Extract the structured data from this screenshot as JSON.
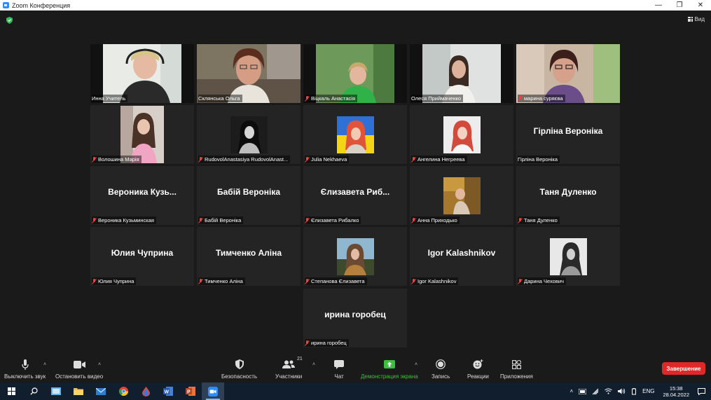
{
  "window": {
    "title": "Zoom Конференция",
    "controls": [
      "minimize",
      "restore",
      "close"
    ]
  },
  "topbar": {
    "view_label": "Вид"
  },
  "participants": [
    {
      "label": "Инна Учитель",
      "muted": false,
      "video": true,
      "bigname": ""
    },
    {
      "label": "Склянська Ольга",
      "muted": false,
      "video": true,
      "bigname": "",
      "active": true
    },
    {
      "label": "Віцкаль Анастасія",
      "muted": true,
      "video": true,
      "bigname": ""
    },
    {
      "label": "Олеся Приймаченко",
      "muted": false,
      "video": true,
      "bigname": ""
    },
    {
      "label": "марина суряєва",
      "muted": true,
      "video": true,
      "bigname": ""
    },
    {
      "label": "Волошина Марія",
      "muted": true,
      "video": false,
      "photo": true,
      "bigname": ""
    },
    {
      "label": "RudovolAnastasiya RudovolAnast...",
      "muted": true,
      "video": false,
      "photo": true,
      "bigname": ""
    },
    {
      "label": "Julia Nekhaeva",
      "muted": true,
      "video": false,
      "photo": true,
      "bigname": ""
    },
    {
      "label": "Ангелина Негреева",
      "muted": true,
      "video": false,
      "photo": true,
      "bigname": ""
    },
    {
      "label": "Гірліна Вероніка",
      "muted": false,
      "video": false,
      "bigname": "Гірліна Вероніка"
    },
    {
      "label": "Вероника Кузьминская",
      "muted": true,
      "video": false,
      "bigname": "Вероника  Кузь..."
    },
    {
      "label": "Бабій Вероніка",
      "muted": true,
      "video": false,
      "bigname": "Бабій Вероніка"
    },
    {
      "label": "Єлизавета Рибалко",
      "muted": true,
      "video": false,
      "bigname": "Єлизавета  Риб..."
    },
    {
      "label": "Анна Приходько",
      "muted": true,
      "video": false,
      "photo": true,
      "bigname": ""
    },
    {
      "label": "Таня Дуленко",
      "muted": true,
      "video": false,
      "bigname": "Таня Дуленко"
    },
    {
      "label": "Юлия Чуприна",
      "muted": true,
      "video": false,
      "bigname": "Юлия Чуприна"
    },
    {
      "label": "Тимченко Аліна",
      "muted": true,
      "video": false,
      "bigname": "Тимченко Аліна"
    },
    {
      "label": "Степанова Єлизавета",
      "muted": true,
      "video": false,
      "photo": true,
      "bigname": ""
    },
    {
      "label": "Igor Kalashnikov",
      "muted": true,
      "video": false,
      "bigname": "Igor Kalashnikov"
    },
    {
      "label": "Дарина Чехович",
      "muted": true,
      "video": false,
      "photo": true,
      "bigname": ""
    },
    {
      "label": "ирина горобец",
      "muted": true,
      "video": false,
      "bigname": "ирина горобец"
    }
  ],
  "toolbar": {
    "mute_label": "Выключить звук",
    "video_label": "Остановить видео",
    "security_label": "Безопасность",
    "participants_label": "Участники",
    "participants_count": "21",
    "chat_label": "Чат",
    "share_label": "Демонстрация экрана",
    "record_label": "Запись",
    "reactions_label": "Реакции",
    "apps_label": "Приложения",
    "end_label": "Завершение"
  },
  "taskbar": {
    "apps": [
      "start-icon",
      "search-icon",
      "file-explorer-icon",
      "folder-icon",
      "mail-icon",
      "chrome-icon",
      "drop-app-icon",
      "word-icon",
      "powerpoint-icon",
      "zoom-icon"
    ],
    "language": "ENG",
    "time": "15:38",
    "date": "28.04.2022"
  },
  "colors": {
    "background": "#1a1a1a",
    "tile": "#242424",
    "active_speaker": "#c9e266",
    "share_green": "#3fbf3f",
    "end_red": "#e02828",
    "zoom_blue": "#2d8cff"
  }
}
